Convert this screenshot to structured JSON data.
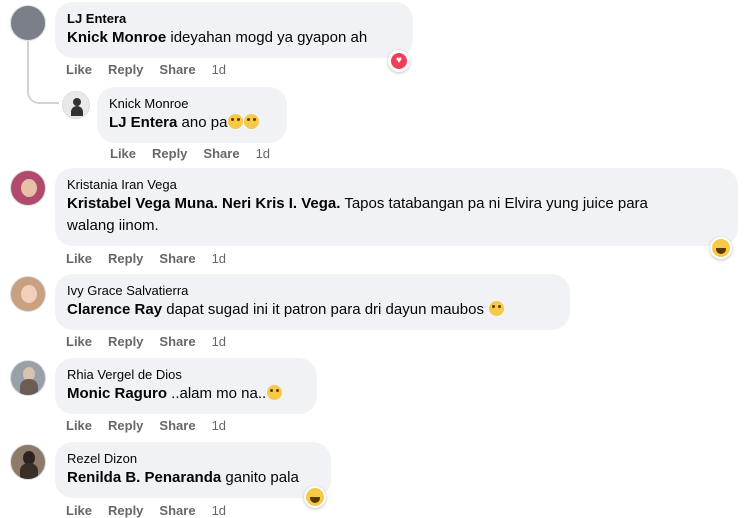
{
  "comments": [
    {
      "author": "LJ Entera",
      "mention": "Knick Monroe",
      "text": " ideyahan mogd ya gyapon ah",
      "actions": {
        "like": "Like",
        "reply": "Reply",
        "share": "Share",
        "time": "1d"
      },
      "reaction": "heart-icon",
      "avatar_color": "#7a7f88"
    },
    {
      "author": "Knick Monroe",
      "mention": "LJ Entera",
      "text": " ano pa",
      "emojis": [
        "squinting-face-icon",
        "squinting-face-icon"
      ],
      "actions": {
        "like": "Like",
        "reply": "Reply",
        "share": "Share",
        "time": "1d"
      },
      "avatar_color": "#e9e9ea"
    },
    {
      "author": "Kristania Iran Vega",
      "mention": "Kristabel Vega Muna. Neri Kris I. Vega.",
      "text_line1": " Tapos tatabangan pa ni Elvira yung juice para",
      "text_line2": "walang iinom.",
      "actions": {
        "like": "Like",
        "reply": "Reply",
        "share": "Share",
        "time": "1d"
      },
      "reaction": "laugh-icon",
      "avatar_color": "#b24a6e"
    },
    {
      "author": "Ivy Grace Salvatierra",
      "mention": "Clarence Ray",
      "text": " dapat sugad ini it patron para dri dayun maubos",
      "emojis": [
        "rofl-face-icon"
      ],
      "actions": {
        "like": "Like",
        "reply": "Reply",
        "share": "Share",
        "time": "1d"
      },
      "avatar_color": "#c9a080"
    },
    {
      "author": "Rhia Vergel de Dios",
      "mention": "Monic Raguro",
      "text": " ..alam mo na..",
      "emojis": [
        "smirk-face-icon"
      ],
      "actions": {
        "like": "Like",
        "reply": "Reply",
        "share": "Share",
        "time": "1d"
      },
      "avatar_color": "#9aa0a8"
    },
    {
      "author": "Rezel Dizon",
      "mention": "Renilda B. Penaranda",
      "text": " ganito pala",
      "actions": {
        "like": "Like",
        "reply": "Reply",
        "share": "Share",
        "time": "1d"
      },
      "reaction": "laugh-icon",
      "avatar_color": "#8d7a68"
    }
  ]
}
